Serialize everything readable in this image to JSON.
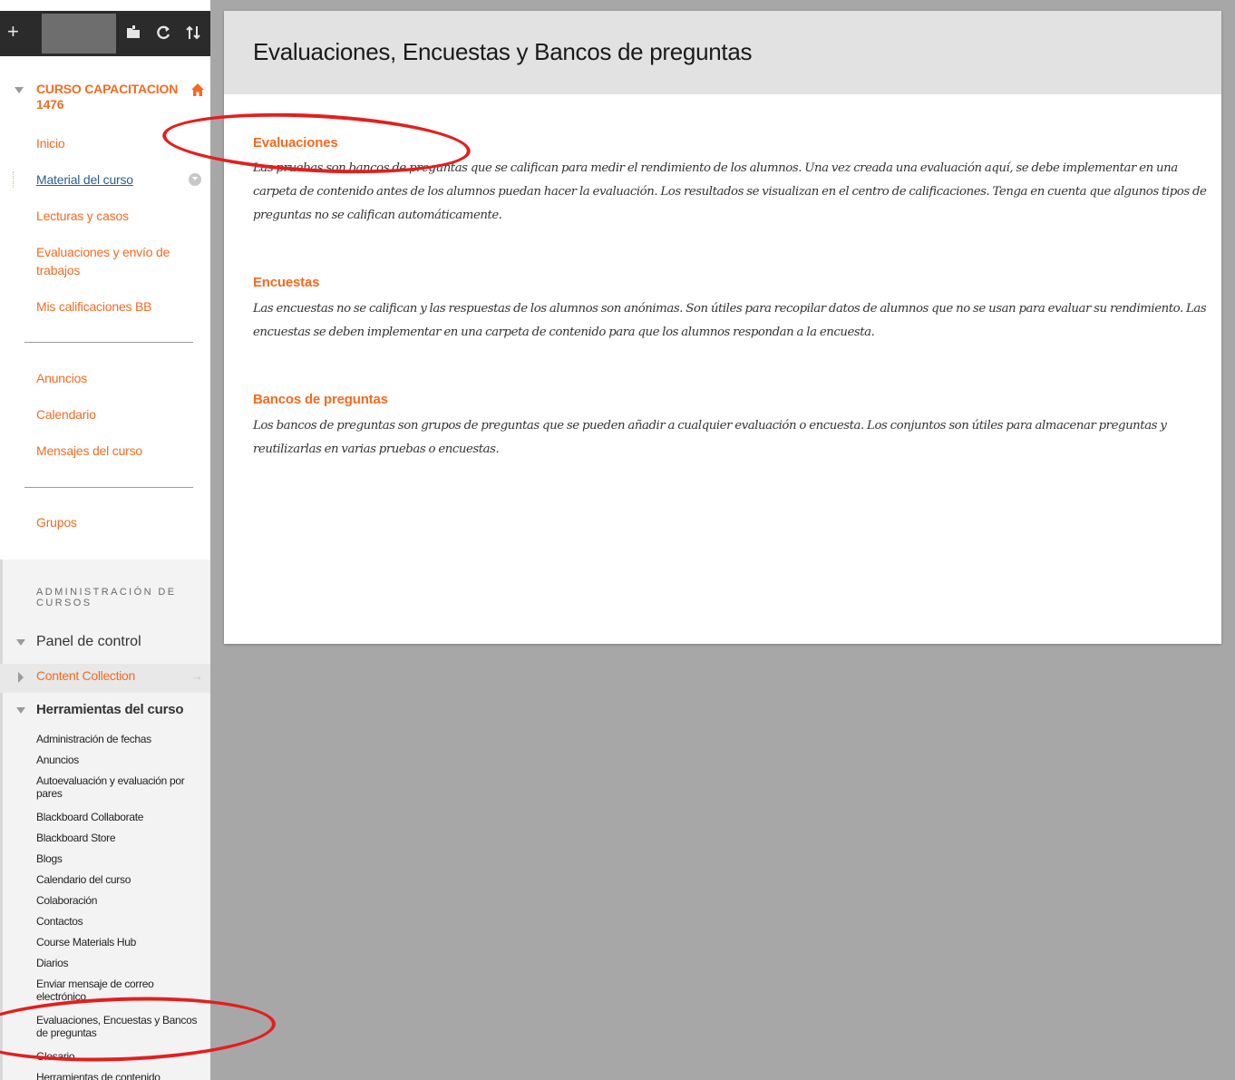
{
  "toolbar": {
    "plus_icon": "+",
    "folder_icon": "folder-icon",
    "refresh_icon": "refresh-icon",
    "sort_icon": "sort-icon"
  },
  "course": {
    "title": "CURSO CAPACITACION 1476"
  },
  "nav": {
    "items": [
      {
        "label": "Inicio"
      },
      {
        "label": "Material del curso"
      },
      {
        "label": "Lecturas y casos"
      },
      {
        "label": "Evaluaciones y envío de trabajos"
      },
      {
        "label": "Mis calificaciones BB"
      },
      {
        "label": "Anuncios"
      },
      {
        "label": "Calendario"
      },
      {
        "label": "Mensajes del curso"
      },
      {
        "label": "Grupos"
      }
    ]
  },
  "admin": {
    "heading": "ADMINISTRACIÓN DE CURSOS",
    "panel_title": "Panel de control",
    "content_collection": "Content Collection",
    "arrow": "→",
    "tools_title": "Herramientas del curso",
    "tools": [
      "Administración de fechas",
      "Anuncios",
      "Autoevaluación y evaluación por pares",
      "Blackboard Collaborate",
      "Blackboard Store",
      "Blogs",
      "Calendario del curso",
      "Colaboración",
      "Contactos",
      "Course Materials Hub",
      "Diarios",
      "Enviar mensaje de correo electrónico",
      "Evaluaciones, Encuestas y Bancos de preguntas",
      "Glosario",
      "Herramientas de contenido"
    ]
  },
  "main": {
    "title": "Evaluaciones, Encuestas y Bancos de preguntas",
    "sections": [
      {
        "title": "Evaluaciones",
        "desc": "Las pruebas son bancos de preguntas que se califican para medir el rendimiento de los alumnos. Una vez creada una evaluación aquí, se debe implementar en una carpeta de contenido antes de los alumnos puedan hacer la evaluación. Los resultados se visualizan en el centro de calificaciones. Tenga en cuenta que algunos tipos de preguntas no se califican automáticamente."
      },
      {
        "title": "Encuestas",
        "desc": "Las encuestas no se califican y las respuestas de los alumnos son anónimas. Son útiles para recopilar datos de alumnos que no se usan para evaluar su rendimiento. Las encuestas se deben implementar en una carpeta de contenido para que los alumnos respondan a la encuesta."
      },
      {
        "title": "Bancos de preguntas",
        "desc": "Los bancos de preguntas son grupos de preguntas que se pueden añadir a cualquier evaluación o encuesta. Los conjuntos son útiles para almacenar preguntas y reutilizarlas en varias pruebas o encuestas."
      }
    ]
  },
  "colors": {
    "accent": "#f26b21",
    "link_active": "#2e5f8a",
    "annotation": "#e41e1e",
    "background": "#a7a7a7"
  }
}
